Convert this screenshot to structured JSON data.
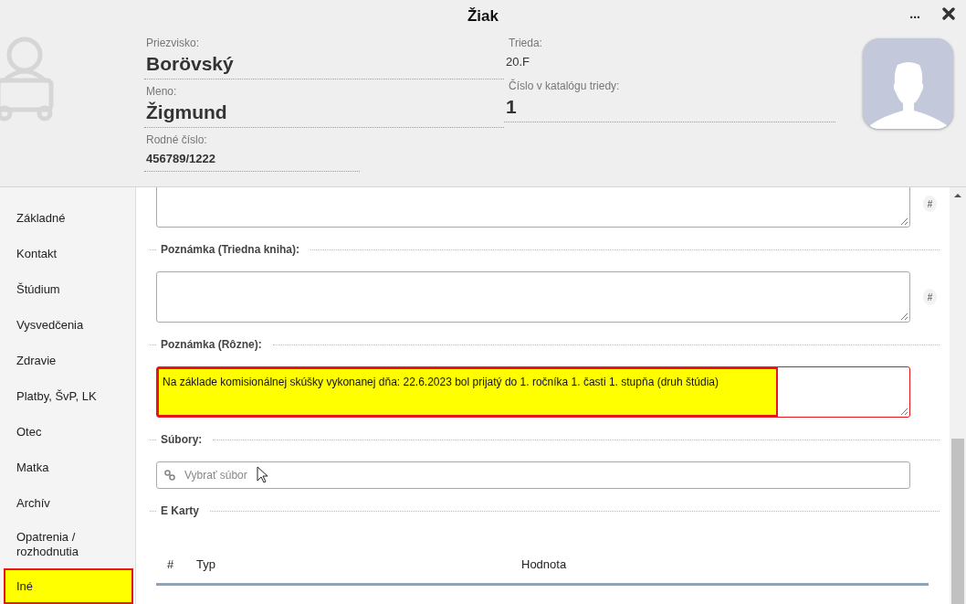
{
  "window": {
    "title": "Žiak",
    "menu_button": "..."
  },
  "header": {
    "left_fields": [
      {
        "kind": "large",
        "label": "Priezvisko:",
        "value": "Borövský"
      },
      {
        "kind": "large",
        "label": "Meno:",
        "value": "Žigmund"
      },
      {
        "kind": "small",
        "label": "Rodné číslo:",
        "value": "456789/1222"
      }
    ],
    "right_fields": [
      {
        "kind": "plain",
        "label": "Trieda:",
        "value": "20.F"
      },
      {
        "kind": "large",
        "label": "Číslo v katalógu triedy:",
        "value": "1"
      }
    ]
  },
  "sidebar": {
    "items": [
      {
        "label": "Základné",
        "selected": false
      },
      {
        "label": "Kontakt",
        "selected": false
      },
      {
        "label": "Štúdium",
        "selected": false
      },
      {
        "label": "Vysvedčenia",
        "selected": false
      },
      {
        "label": "Zdravie",
        "selected": false
      },
      {
        "label": "Platby, ŠvP, LK",
        "selected": false
      },
      {
        "label": "Otec",
        "selected": false
      },
      {
        "label": "Matka",
        "selected": false
      },
      {
        "label": "Archív",
        "selected": false
      },
      {
        "label": "Opatrenia / rozhodnutia",
        "selected": false
      },
      {
        "label": "Iné",
        "selected": true
      }
    ]
  },
  "form": [
    {
      "kind": "textarea",
      "side_button": "#"
    },
    {
      "kind": "heading",
      "label": "Poznámka (Triedna kniha):"
    },
    {
      "kind": "textarea",
      "side_button": "#"
    },
    {
      "kind": "heading",
      "label": "Poznámka (Rôzne):"
    },
    {
      "kind": "textarea",
      "value": "Na základe komisionálnej skúšky vykonanej dňa: 22.6.2023 bol prijatý do 1. ročníka 1. časti 1. stupňa (druh štúdia)",
      "highlighted": true
    },
    {
      "kind": "heading",
      "label": "Súbory:"
    },
    {
      "kind": "file",
      "placeholder": "Vybrať súbor"
    },
    {
      "kind": "heading",
      "label": "E Karty"
    },
    {
      "kind": "table",
      "columns": [
        "#",
        "Typ",
        "Hodnota"
      ]
    }
  ]
}
